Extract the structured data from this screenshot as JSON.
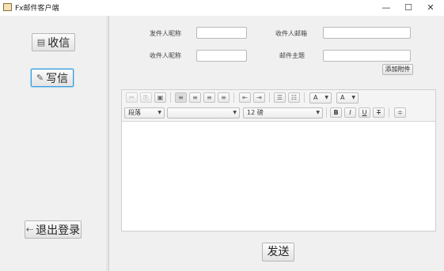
{
  "window": {
    "title": "Fx邮件客户端",
    "minimize": "—",
    "maximize": "☐",
    "close": "✕"
  },
  "sidebar": {
    "receive": {
      "label": "收信",
      "icon": "inbox-icon",
      "glyph": "▤"
    },
    "compose": {
      "label": "写信",
      "icon": "compose-icon",
      "glyph": "✎"
    },
    "logout": {
      "label": "退出登录",
      "icon": "logout-icon",
      "glyph": "⇠"
    }
  },
  "form": {
    "sender_nick_label": "发件人昵称",
    "sender_nick_value": "",
    "recipient_email_label": "收件人邮箱",
    "recipient_email_value": "",
    "recipient_nick_label": "收件人昵称",
    "recipient_nick_value": "",
    "subject_label": "邮件主题",
    "subject_value": "",
    "attach_label": "添加附件"
  },
  "editor": {
    "toolbar1": {
      "cut": "✂",
      "copy": "⎘",
      "paste": "▣",
      "align_left": "≡",
      "align_center": "≡",
      "align_right": "≡",
      "justify": "≡",
      "outdent": "⇤",
      "indent": "⇥",
      "bullets": "☰",
      "numbers": "☷",
      "text_color": "A",
      "highlight": "A"
    },
    "toolbar2": {
      "paragraph": "段落",
      "font_family": "",
      "font_size": "12 磅",
      "bold": "B",
      "italic": "I",
      "underline": "U",
      "strike": "T",
      "hr": "≑"
    },
    "body": ""
  },
  "send_label": "发送",
  "colors": {
    "accent": "#3c9bd8",
    "panel": "#f0f0f0"
  }
}
